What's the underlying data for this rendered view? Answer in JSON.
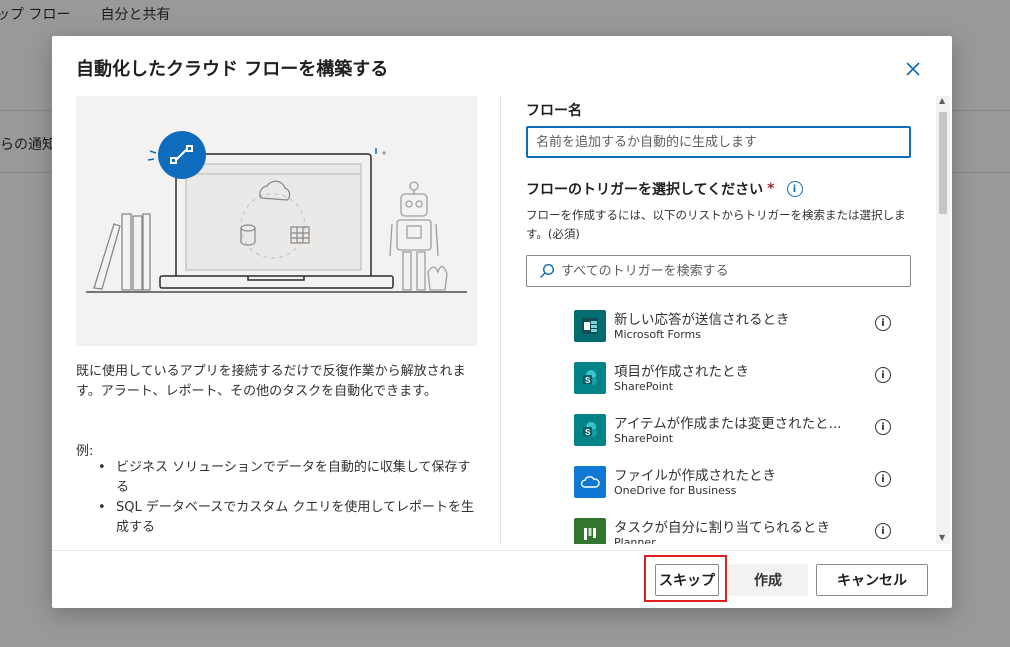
{
  "background": {
    "tabs": [
      "ップ フロー",
      "自分と共有"
    ],
    "notify_text": "らの通知"
  },
  "dialog": {
    "title": "自動化したクラウド フローを構築する",
    "description": "既に使用しているアプリを接続するだけで反復作業から解放されます。アラート、レポート、その他のタスクを自動化できます。",
    "examples_label": "例:",
    "examples": [
      "ビジネス ソリューションでデータを自動的に収集して保存する",
      "SQL データベースでカスタム クエリを使用してレポートを生成する"
    ],
    "flow_name_label": "フロー名",
    "flow_name_placeholder": "名前を追加するか自動的に生成します",
    "trigger_label": "フローのトリガーを選択してください",
    "required_mark": "*",
    "trigger_help": "フローを作成するには、以下のリストからトリガーを検索または選択します。(必須)",
    "search_placeholder": "すべてのトリガーを検索する",
    "triggers": [
      {
        "title": "新しい応答が送信されるとき",
        "connector": "Microsoft Forms",
        "color": "#036c70",
        "icon": "forms-icon"
      },
      {
        "title": "項目が作成されたとき",
        "connector": "SharePoint",
        "color": "#038387",
        "icon": "sharepoint-icon"
      },
      {
        "title": "アイテムが作成または変更されたと...",
        "connector": "SharePoint",
        "color": "#038387",
        "icon": "sharepoint-icon"
      },
      {
        "title": "ファイルが作成されたとき",
        "connector": "OneDrive for Business",
        "color": "#0f78d4",
        "icon": "onedrive-icon"
      },
      {
        "title": "タスクが自分に割り当てられるとき",
        "connector": "Planner",
        "color": "#31752f",
        "icon": "planner-icon"
      }
    ],
    "buttons": {
      "skip": "スキップ",
      "create": "作成",
      "cancel": "キャンセル"
    }
  }
}
